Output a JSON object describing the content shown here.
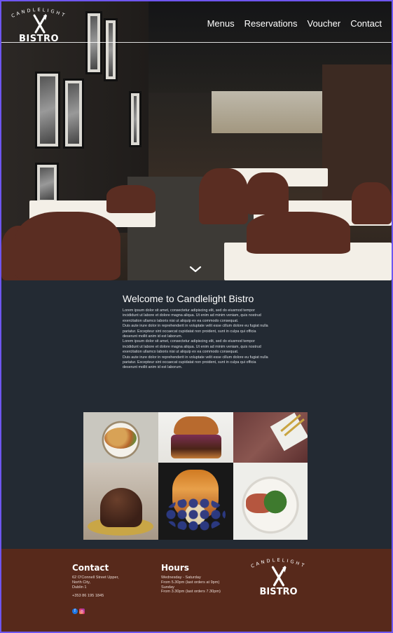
{
  "brand": {
    "arc_text": "CANDLELIGHT",
    "name": "BISTRO"
  },
  "nav": {
    "items": [
      "Menus",
      "Reservations",
      "Voucher",
      "Contact"
    ]
  },
  "welcome": {
    "title": "Welcome to Candlelight Bistro",
    "paragraphs": [
      "Lorem ipsum dolor sit amet, consectetur adipiscing elit, sed do eiusmod tempor incididunt ut labore et dolore magna aliqua. Ut enim ad minim veniam, quis nostrud exercitation ullamco laboris nisi ut aliquip ex ea commodo consequat.",
      "Duis aute irure dolor in reprehenderit in voluptate velit esse cillum dolore eu fugiat nulla pariatur. Excepteur sint occaecat cupidatat non proident, sunt in culpa qui officia deserunt mollit anim id est laborum.",
      "Lorem ipsum dolor sit amet, consectetur adipiscing elit, sed do eiusmod tempor incididunt ut labore et dolore magna aliqua. Ut enim ad minim veniam, quis nostrud exercitation ullamco laboris nisi ut aliquip ex ea commodo consequat.",
      "Duis aute irure dolor in reprehenderit in voluptate velit esse cillum dolore eu fugiat nulla pariatur. Excepteur sint occaecat cupidatat non proident, sunt in culpa qui officia deserunt mollit anim id est laborum."
    ]
  },
  "footer": {
    "contact": {
      "title": "Contact",
      "address": [
        "62 O'Connell Street Upper,",
        "North City,",
        "Dublin 1"
      ],
      "phone": "+353 86 195 1845"
    },
    "hours": {
      "title": "Hours",
      "lines": [
        "Wednesday - Saturday",
        "From 5.30pm (last orders at 9pm)",
        "Sunday",
        "From 3.30pm (last orders 7.30pm)"
      ]
    },
    "social": {
      "facebook_icon": "f",
      "instagram_icon": "◎"
    }
  },
  "colors": {
    "accent": "#6e56f0",
    "body_bg": "#232a33",
    "footer_bg": "#57291b"
  }
}
